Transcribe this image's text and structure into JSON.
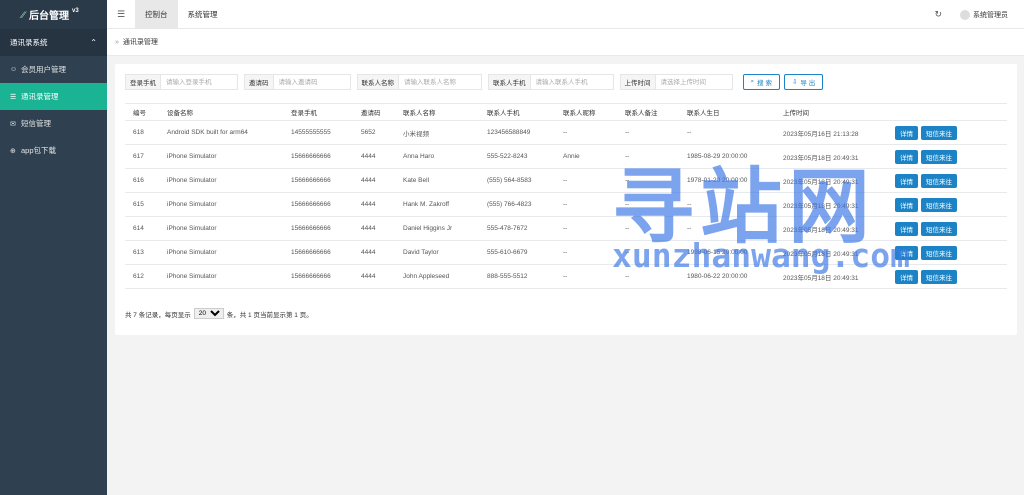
{
  "sidebar": {
    "logo_text": "后台管理",
    "logo_version": "v3",
    "group_label": "通讯录系统",
    "items": [
      {
        "icon": "users-icon",
        "glyph": "☺",
        "label": "会员用户管理",
        "active": false
      },
      {
        "icon": "contacts-icon",
        "glyph": "☰",
        "label": "通讯录管理",
        "active": true
      },
      {
        "icon": "sms-icon",
        "glyph": "✉",
        "label": "短信管理",
        "active": false
      },
      {
        "icon": "download-icon",
        "glyph": "⊕",
        "label": "app包下载",
        "active": false
      }
    ]
  },
  "topbar": {
    "tabs": [
      "控制台",
      "系统管理"
    ],
    "user": "系统管理员"
  },
  "breadcrumb": "通讯录管理",
  "filters": [
    {
      "label": "登录手机",
      "placeholder": "请输入登录手机"
    },
    {
      "label": "邀请码",
      "placeholder": "请输入邀请码"
    },
    {
      "label": "联系人名称",
      "placeholder": "请输入联系人名称"
    },
    {
      "label": "联系人手机",
      "placeholder": "请输入联系人手机"
    },
    {
      "label": "上传时间",
      "placeholder": "请选择上传时间"
    }
  ],
  "buttons": {
    "search": "搜 索",
    "export": "导 出"
  },
  "table": {
    "columns": [
      "编号",
      "设备名称",
      "登录手机",
      "邀请码",
      "联系人名称",
      "联系人手机",
      "联系人昵称",
      "联系人备注",
      "联系人生日",
      "上传时间"
    ],
    "rows": [
      [
        "618",
        "Android SDK built for arm64",
        "14555555555",
        "5652",
        "小米视频",
        "123456588849",
        "--",
        "--",
        "--",
        "2023年05月16日 21:13:28"
      ],
      [
        "617",
        "iPhone Simulator",
        "15666666666",
        "4444",
        "Anna Haro",
        "555-522-8243",
        "Annie",
        "--",
        "1985-08-29 20:00:00",
        "2023年05月18日 20:49:31"
      ],
      [
        "616",
        "iPhone Simulator",
        "15666666666",
        "4444",
        "Kate Bell",
        "(555) 564-8583",
        "--",
        "--",
        "1978-01-20 20:00:00",
        "2023年05月18日 20:49:31"
      ],
      [
        "615",
        "iPhone Simulator",
        "15666666666",
        "4444",
        "Hank M. Zakroff",
        "(555) 766-4823",
        "--",
        "--",
        "--",
        "2023年05月18日 20:49:31"
      ],
      [
        "614",
        "iPhone Simulator",
        "15666666666",
        "4444",
        "Daniel Higgins Jr",
        "555-478-7672",
        "--",
        "--",
        "--",
        "2023年05月18日 20:49:31"
      ],
      [
        "613",
        "iPhone Simulator",
        "15666666666",
        "4444",
        "David Taylor",
        "555-610-6679",
        "--",
        "--",
        "1998-06-15 20:00:00",
        "2023年05月18日 20:49:31"
      ],
      [
        "612",
        "iPhone Simulator",
        "15666666666",
        "4444",
        "John Appleseed",
        "888-555-5512",
        "--",
        "--",
        "1980-06-22 20:00:00",
        "2023年05月18日 20:49:31"
      ]
    ],
    "ops": [
      "详情",
      "短信来往"
    ]
  },
  "pager": {
    "prefix": "共 7 条记录，每页显示",
    "page_size": "20",
    "suffix": "条，共 1 页当前显示第 1 页。"
  },
  "watermark": {
    "cn": "寻站网",
    "en": "xunzhanwang.com"
  }
}
